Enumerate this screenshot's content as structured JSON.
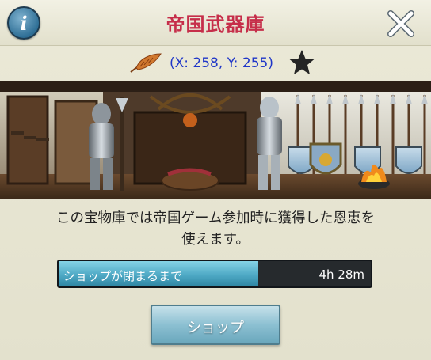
{
  "header": {
    "title": "帝国武器庫",
    "info_icon": "info-icon",
    "info_label": "i",
    "close_icon": "close-icon"
  },
  "location": {
    "coords_text": "(X: 258, Y: 255)",
    "feather_icon": "feather-icon",
    "star_icon": "star-icon"
  },
  "scene": {
    "image_desc_icon": "armory-illustration"
  },
  "body": {
    "description_line1": "この宝物庫では帝国ゲーム参加時に獲得した恩恵を",
    "description_line2": "使えます。"
  },
  "timer": {
    "label": "ショップが閉まるまで",
    "time": "4h 28m",
    "progress_fraction": 0.64
  },
  "actions": {
    "shop_label": "ショップ"
  },
  "colors": {
    "title": "#c62e4a",
    "coords": "#1f36c8",
    "progress_fill": "#4ea9c5",
    "button": "#8cc0d2"
  }
}
